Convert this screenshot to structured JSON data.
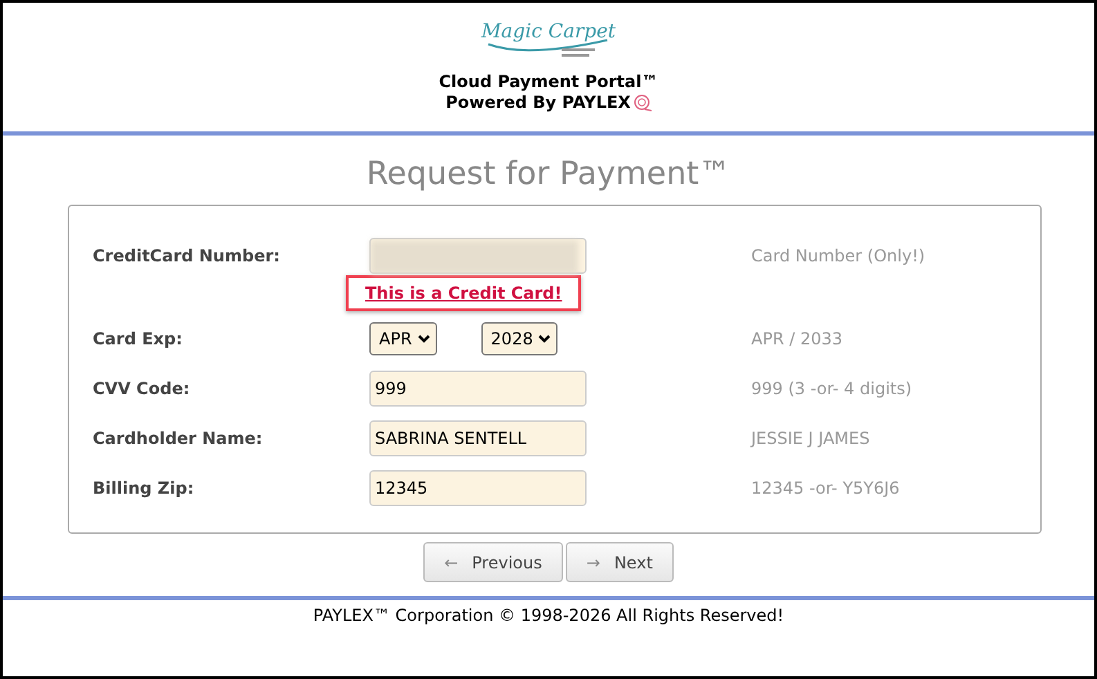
{
  "header": {
    "logo_text": "Magic Carpet",
    "portal_title": "Cloud Payment Portal™",
    "powered_by": "Powered By PAYLEX"
  },
  "page_title": "Request for Payment™",
  "form": {
    "rows": [
      {
        "kind": "input",
        "label": "CreditCard Number:",
        "value": "",
        "redacted": true,
        "hint": "Card Number (Only!)"
      },
      {
        "kind": "notice",
        "text": "This is a Credit Card!"
      },
      {
        "kind": "selects",
        "label": "Card Exp:",
        "selects": [
          "APR",
          "2028"
        ],
        "hint": "APR / 2033"
      },
      {
        "kind": "input",
        "label": "CVV Code:",
        "value": "999",
        "redacted": false,
        "hint": "999 (3 -or- 4 digits)"
      },
      {
        "kind": "input",
        "label": "Cardholder Name:",
        "value": "SABRINA SENTELL",
        "redacted": false,
        "hint": "JESSIE J JAMES"
      },
      {
        "kind": "input",
        "label": "Billing Zip:",
        "value": "12345",
        "redacted": false,
        "hint": "12345 -or- Y5Y6J6"
      }
    ]
  },
  "buttons": [
    {
      "icon": "←",
      "label": "Previous"
    },
    {
      "icon": "→",
      "label": "Next"
    }
  ],
  "footer": "PAYLEX™ Corporation © 1998-2026 All Rights Reserved!"
}
